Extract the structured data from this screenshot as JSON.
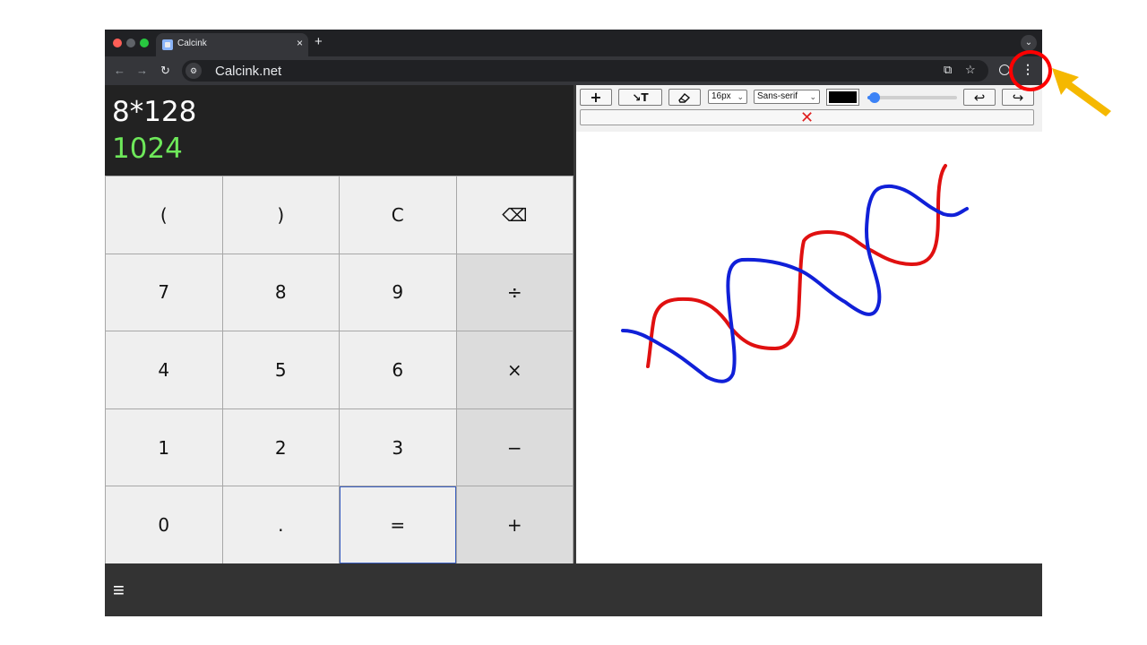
{
  "browser": {
    "tab_title": "Calcink",
    "tab_close": "×",
    "new_tab": "+",
    "url": "Calcink.net",
    "icons": [
      "back-arrow-icon",
      "forward-arrow-icon",
      "reload-icon",
      "site-settings-icon",
      "cast-icon",
      "star-icon",
      "profile-icon",
      "kebab-menu-icon"
    ]
  },
  "calculator": {
    "expression": "8*128",
    "result": "1024",
    "result_color": "#6ee85a",
    "keys": [
      "(",
      ")",
      "C",
      "⌫",
      "7",
      "8",
      "9",
      "÷",
      "4",
      "5",
      "6",
      "×",
      "1",
      "2",
      "3",
      "−",
      "0",
      ".",
      "=",
      "+"
    ]
  },
  "drawing": {
    "toolbar": {
      "move_label": "+",
      "text_label": "↘T",
      "eraser_label": "⌫",
      "size_value": "16px",
      "font_value": "Sans-serif",
      "pen_color": "#000000",
      "stroke_width_fraction": 0.08,
      "undo_label": "↩",
      "redo_label": "↪",
      "clear_label": "✕"
    },
    "stroke_colors": {
      "red": "#e01010",
      "blue": "#1020d8"
    }
  },
  "footer": {
    "menu_label": "≡"
  },
  "annotation": {
    "circle_color": "#ff0000",
    "arrow_color": "#f5b800"
  }
}
